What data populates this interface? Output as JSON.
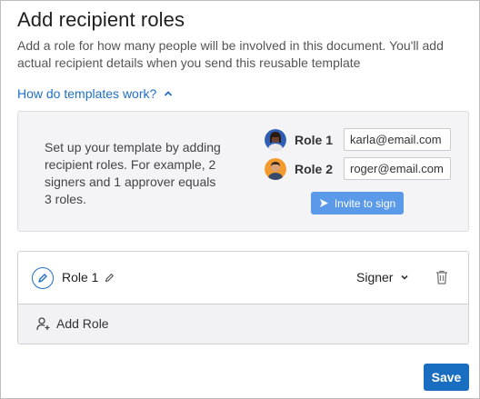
{
  "dialog": {
    "title": "Add recipient roles",
    "description": "Add a role for how many people will be involved in this document. You'll add actual recipient details when you send this reusable template"
  },
  "help": {
    "link_label": "How do templates work?",
    "info_text": "Set up your template by adding recipient roles. For example, 2 signers and 1 approver equals 3 roles.",
    "example_roles": [
      {
        "label": "Role 1",
        "email": "karla@email.com"
      },
      {
        "label": "Role 2",
        "email": "roger@email.com"
      }
    ],
    "invite_label": "Invite to sign"
  },
  "roles": [
    {
      "name": "Role 1",
      "type": "Signer"
    }
  ],
  "add_role_label": "Add Role",
  "save_label": "Save",
  "colors": {
    "accent": "#1a6ec2",
    "link": "#1f6fc5",
    "invite": "#5b9ae8"
  }
}
